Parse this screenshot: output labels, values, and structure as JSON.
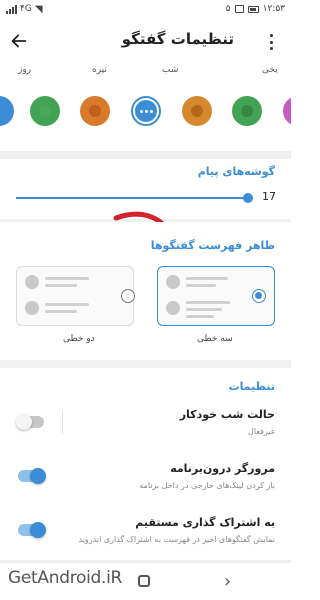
{
  "status_bar": {
    "time": "۱۲:۵۳",
    "network": "۴G",
    "notification_count": "۵"
  },
  "app_bar": {
    "title": "تنظیمات گفتگو",
    "back_icon": "arrow-left-icon",
    "menu_icon": "more-vertical-icon"
  },
  "theme": {
    "labels": [
      "روز",
      "تیره",
      "شب",
      "یخی"
    ],
    "swatches": [
      {
        "color": "#3a8dd6",
        "inner": "#3a8dd6"
      },
      {
        "color": "#c75bc2",
        "inner": "#c75bc2"
      },
      {
        "color": "#43a354",
        "inner": "#4aa85c"
      },
      {
        "color": "#d87a2a",
        "inner": "#c05e1b"
      },
      {
        "color": "#3a8dd6",
        "selected": true
      },
      {
        "color": "#d6892c",
        "inner": "#b5661a"
      },
      {
        "color": "#43a354",
        "inner": "#35883f"
      },
      {
        "color": "#c75bc2",
        "inner": "#c75bc2"
      },
      {
        "color": "#3a8dd6",
        "inner": "#3a8dd6"
      }
    ]
  },
  "message_corners": {
    "title": "گوشه‌های پیام",
    "value": "17",
    "fraction": 0.97
  },
  "chat_list_look": {
    "title": "ظاهر فهرست گفتگوها",
    "option_three_line": "سه خطی",
    "option_two_line": "دو خطی",
    "selected": "three_line"
  },
  "settings": {
    "title": "تنظیمات",
    "rows": [
      {
        "title": "حالت شب خودکار",
        "subtitle": "غیرفعال",
        "on": false
      },
      {
        "title": "مرورگر درون‌برنامه",
        "subtitle": "باز کردن لینک‌های خارجی در داخل برنامه",
        "on": true
      },
      {
        "title": "به اشتراک گذاری مستقیم",
        "subtitle": "نمایش گفتگوهای اخیر در فهرست به اشتراک گذاری اندروید",
        "on": true
      }
    ]
  },
  "watermark": "GetAndroid.iR",
  "colors": {
    "accent": "#3a8dd6",
    "annotation_arrow": "#d3212d"
  }
}
